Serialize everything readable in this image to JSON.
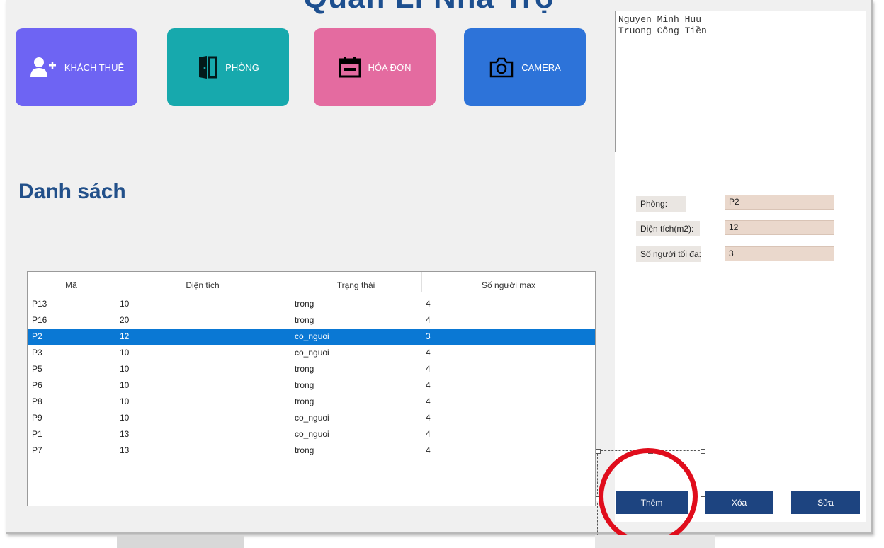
{
  "window": {
    "title": "Quản Lí Nhà Trọ"
  },
  "tiles": [
    {
      "label": "KHÁCH THUÊ",
      "icon": "add-user-icon",
      "color": "#6e64f3"
    },
    {
      "label": "PHÒNG",
      "icon": "door-icon",
      "color": "#17a9ad"
    },
    {
      "label": "HÓA ĐƠN",
      "icon": "calendar-icon",
      "color": "#e46ba0"
    },
    {
      "label": "CAMERA",
      "icon": "camera-icon",
      "color": "#2d73d9"
    }
  ],
  "list": {
    "heading": "Danh sách",
    "columns": [
      "Mã",
      "Diện tích",
      "Trạng thái",
      "Số người max"
    ],
    "rows": [
      [
        "P13",
        "10",
        "trong",
        "4"
      ],
      [
        "P16",
        "20",
        "trong",
        "4"
      ],
      [
        "P2",
        "12",
        "co_nguoi",
        "3"
      ],
      [
        "P3",
        "10",
        "co_nguoi",
        "4"
      ],
      [
        "P5",
        "10",
        "trong",
        "4"
      ],
      [
        "P6",
        "10",
        "trong",
        "4"
      ],
      [
        "P8",
        "10",
        "trong",
        "4"
      ],
      [
        "P9",
        "10",
        "co_nguoi",
        "4"
      ],
      [
        "P1",
        "13",
        "co_nguoi",
        "4"
      ],
      [
        "P7",
        "13",
        "trong",
        "4"
      ]
    ],
    "selected_index": 2
  },
  "members": {
    "lines": [
      "Nguyen Minh Huu",
      "Truong Công Tiền"
    ]
  },
  "form": {
    "room_label": "Phòng:",
    "room_value": "P2",
    "area_label": "Diện tích(m2):",
    "area_value": "12",
    "max_label": "Số người tối đa:",
    "max_value": "3"
  },
  "buttons": {
    "add": "Thêm",
    "delete": "Xóa",
    "edit": "Sửa"
  },
  "colors": {
    "accent": "#1d4480",
    "selection": "#0a78d4",
    "annotation": "#e00d1c"
  }
}
